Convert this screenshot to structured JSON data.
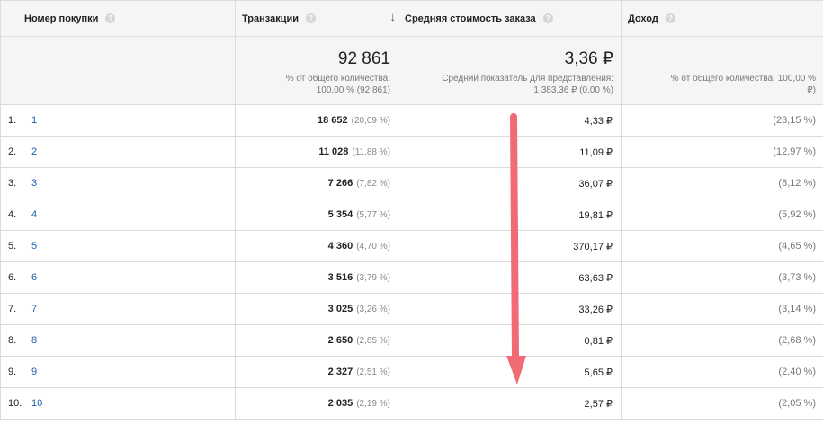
{
  "columns": [
    {
      "label": "Номер покупки",
      "help": "?"
    },
    {
      "label": "Транзакции",
      "help": "?",
      "sort_icon": "↓"
    },
    {
      "label": "Средняя стоимость заказа",
      "help": "?"
    },
    {
      "label": "Доход",
      "help": "?"
    }
  ],
  "summary": {
    "transactions_total": "92 861",
    "transactions_note": "% от общего количества:",
    "transactions_note2": "100,00 % (92 861)",
    "avg_value": "3,36 ₽",
    "avg_note": "Средний показатель для представления:",
    "avg_note2": "1 383,36 ₽ (0,00 %)",
    "revenue_note": "% от общего количества: 100,00 %",
    "revenue_note2": "₽)"
  },
  "rows": [
    {
      "idx": "1.",
      "label": "1",
      "tx": "18 652",
      "tx_pct": "(20,09 %)",
      "avg": "4,33 ₽",
      "rev_pct": "(23,15 %)"
    },
    {
      "idx": "2.",
      "label": "2",
      "tx": "11 028",
      "tx_pct": "(11,88 %)",
      "avg": "11,09 ₽",
      "rev_pct": "(12,97 %)"
    },
    {
      "idx": "3.",
      "label": "3",
      "tx": "7 266",
      "tx_pct": "(7,82 %)",
      "avg": "36,07 ₽",
      "rev_pct": "(8,12 %)"
    },
    {
      "idx": "4.",
      "label": "4",
      "tx": "5 354",
      "tx_pct": "(5,77 %)",
      "avg": "19,81 ₽",
      "rev_pct": "(5,92 %)"
    },
    {
      "idx": "5.",
      "label": "5",
      "tx": "4 360",
      "tx_pct": "(4,70 %)",
      "avg": "370,17 ₽",
      "rev_pct": "(4,65 %)"
    },
    {
      "idx": "6.",
      "label": "6",
      "tx": "3 516",
      "tx_pct": "(3,79 %)",
      "avg": "63,63 ₽",
      "rev_pct": "(3,73 %)"
    },
    {
      "idx": "7.",
      "label": "7",
      "tx": "3 025",
      "tx_pct": "(3,26 %)",
      "avg": "33,26 ₽",
      "rev_pct": "(3,14 %)"
    },
    {
      "idx": "8.",
      "label": "8",
      "tx": "2 650",
      "tx_pct": "(2,85 %)",
      "avg": "0,81 ₽",
      "rev_pct": "(2,68 %)"
    },
    {
      "idx": "9.",
      "label": "9",
      "tx": "2 327",
      "tx_pct": "(2,51 %)",
      "avg": "5,65 ₽",
      "rev_pct": "(2,40 %)"
    },
    {
      "idx": "10.",
      "label": "10",
      "tx": "2 035",
      "tx_pct": "(2,19 %)",
      "avg": "2,57 ₽",
      "rev_pct": "(2,05 %)"
    }
  ],
  "annotation": {
    "icon": "arrow-down-icon",
    "color": "#f06b74"
  }
}
